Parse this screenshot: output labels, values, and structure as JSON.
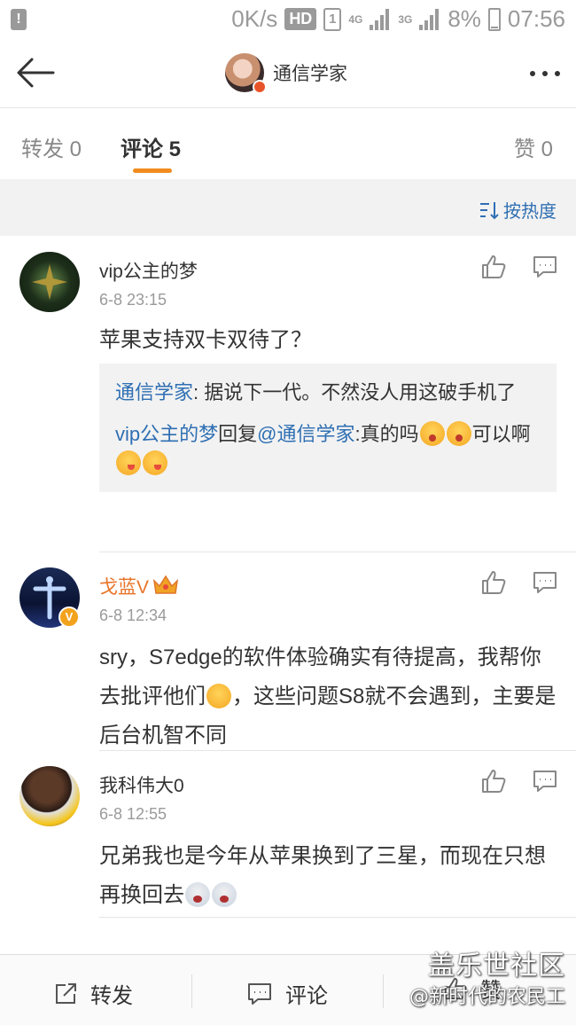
{
  "status_bar": {
    "speed": "0K/s",
    "hd": "HD",
    "sim": "1",
    "net1": "4G",
    "net2": "3G",
    "battery": "8%",
    "time": "07:56"
  },
  "nav": {
    "title": "通信学家"
  },
  "tabs": [
    {
      "label": "转发 0",
      "active": false
    },
    {
      "label": "评论 5",
      "active": true
    },
    {
      "label": "赞 0",
      "active": false
    }
  ],
  "sort_label": "按热度",
  "comments": [
    {
      "user": "vip公主的梦",
      "time": "6-8 23:15",
      "text": "苹果支持双卡双待了？",
      "replies": [
        {
          "author": "通信学家",
          "sep": ": ",
          "body": "据说下一代。不然没人用这破手机了"
        },
        {
          "author": "vip公主的梦",
          "mid": "回复",
          "mention": "@通信学家",
          "body": ":真的吗",
          "tail": "可以啊"
        }
      ]
    },
    {
      "user": "戈蓝V",
      "time": "6-8 12:34",
      "text_a": "sry，S7edge的软件体验确实有待提高，我帮你去批评他们",
      "text_b": "，这些问题S8就不会遇到，主要是后台机智不同"
    },
    {
      "user": "我科伟大0",
      "time": "6-8 12:55",
      "text": "兄弟我也是今年从苹果换到了三星，而现在只想再换回去"
    }
  ],
  "bottom_bar": {
    "repost": "转发",
    "comment": "评论",
    "like": "赞"
  },
  "watermark": {
    "line1": "盖乐世社区",
    "line2": "@新时代的农民工"
  }
}
